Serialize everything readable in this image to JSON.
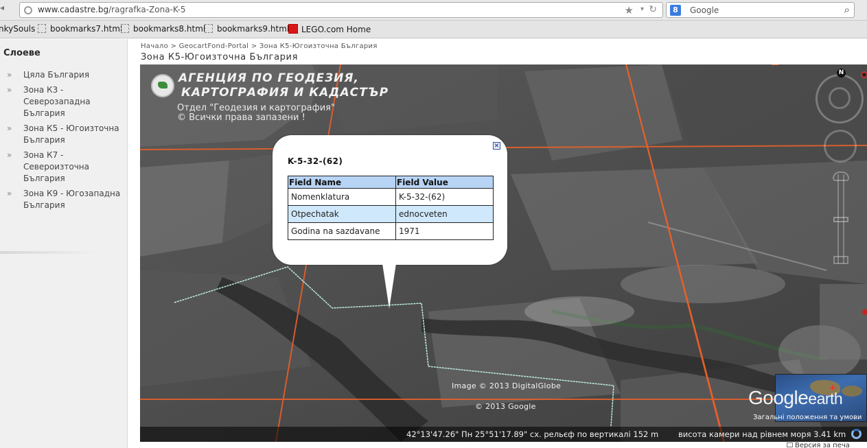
{
  "browser": {
    "url_host": "www.cadastre.bg",
    "url_path": "/ragrafka-Zona-K-5",
    "search_placeholder": "Google",
    "search_engine_label": "8"
  },
  "bookmarks": [
    {
      "label": "nkySouls",
      "icon": "none"
    },
    {
      "label": "bookmarks7.html",
      "icon": "page-icon"
    },
    {
      "label": "bookmarks8.html",
      "icon": "page-icon"
    },
    {
      "label": "bookmarks9.html",
      "icon": "page-icon"
    },
    {
      "label": "LEGO.com Home",
      "icon": "lego-icon"
    }
  ],
  "sidebar": {
    "title": "Слоеве",
    "items": [
      {
        "label": "Цяла България"
      },
      {
        "label": "Зона К3 - Северозападна България"
      },
      {
        "label": "Зона К5 - Югоизточна България"
      },
      {
        "label": "Зона К7 - Североизточна България"
      },
      {
        "label": "Зона К9 - Югозападна България"
      }
    ],
    "arrow_glyph": "»"
  },
  "header": {
    "breadcrumb": "Начало > GeocartFond-Portal > Зона К5-Югоизточна България",
    "title": "Зона К5-Югоизточна България"
  },
  "map": {
    "agency_name_line1": "АГЕНЦИЯ ПО ГЕОДЕЗИЯ,",
    "agency_name_line2": "КАРТОГРАФИЯ И КАДАСТЪР",
    "agency_dept": "Отдел \"Геодезия и картография\"",
    "agency_rights": "© Всички права запазени !",
    "copyright_imagery": "Image © 2013 DigitalGlobe",
    "copyright_google": "© 2013 Google",
    "brand_google": "Google",
    "brand_earth": "earth",
    "terms_link": "Загальні положення та умови",
    "north_label": "N",
    "status_coords": "42°13'47.26\" Пн   25°51'17.89\" сх.  рельєф по вертикалі   152 m",
    "status_altitude": "висота камери над рівнем моря   3.41 km",
    "colors": {
      "grid_lines": "#e8602a",
      "parcel_outline": "#bfeee6"
    }
  },
  "popup": {
    "title": "K-5-32-(62)",
    "close_label": "×",
    "columns": [
      "Field Name",
      "Field Value"
    ],
    "rows": [
      {
        "name": "Nomenklatura",
        "value": "K-5-32-(62)"
      },
      {
        "name": "Otpechatak",
        "value": "ednocveten"
      },
      {
        "name": "Godina na sazdavane",
        "value": "1971"
      }
    ]
  },
  "footer": {
    "version_link": "Версия за печа"
  }
}
